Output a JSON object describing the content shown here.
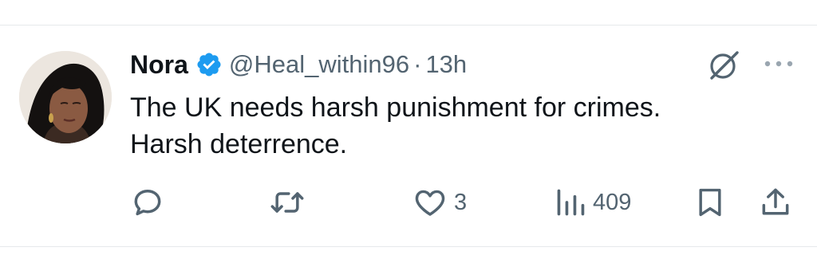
{
  "tweet": {
    "author": {
      "name": "Nora",
      "handle": "@Heal_within96",
      "verified": true
    },
    "separator": "·",
    "time": "13h",
    "text_lines": [
      "The UK needs harsh punishment for crimes.",
      "Harsh deterrence."
    ],
    "actions": {
      "reply": {
        "icon": "reply-icon",
        "count": ""
      },
      "retweet": {
        "icon": "retweet-icon",
        "count": ""
      },
      "like": {
        "icon": "heart-icon",
        "count": "3"
      },
      "views": {
        "icon": "views-chart-icon",
        "count": "409"
      },
      "bookmark": {
        "icon": "bookmark-icon"
      },
      "share": {
        "icon": "share-icon"
      }
    },
    "header_icons": [
      "grok-icon",
      "more-options-icon"
    ]
  },
  "colors": {
    "text_primary": "#0f1419",
    "text_secondary": "#536471",
    "verified_blue": "#1d9bf0",
    "divider": "#e6e9eb"
  }
}
